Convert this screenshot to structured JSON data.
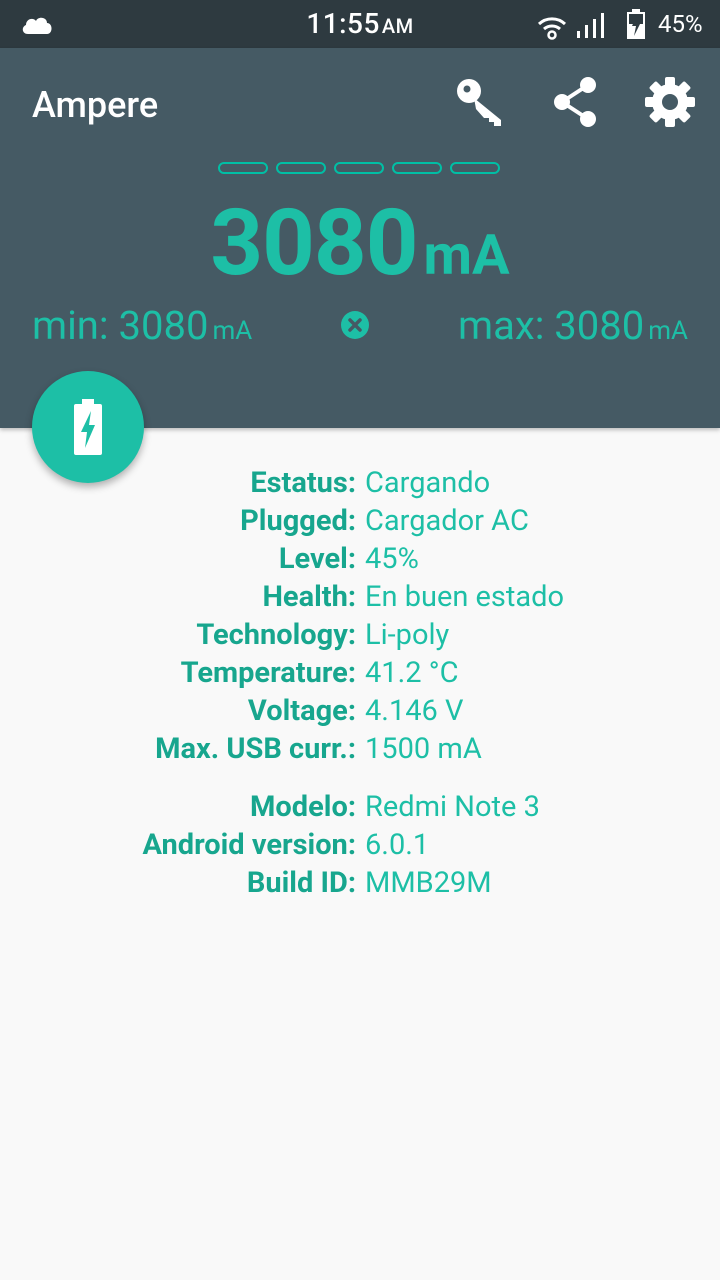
{
  "status_bar": {
    "time": "11:55",
    "ampm": "AM",
    "battery_percent": "45%"
  },
  "toolbar": {
    "title": "Ampere",
    "actions": [
      "key-icon",
      "share-icon",
      "gear-icon"
    ]
  },
  "meter": {
    "current_value": "3080",
    "current_unit": "mA",
    "min_label": "min: 3080",
    "min_unit": "mA",
    "max_label": "max: 3080",
    "max_unit": "mA",
    "accent_color": "#1dbfa6",
    "header_color": "#455a64"
  },
  "fab": {
    "icon": "battery-charging-icon"
  },
  "battery_info": [
    {
      "label": "Estatus:",
      "value": "Cargando"
    },
    {
      "label": "Plugged:",
      "value": "Cargador AC"
    },
    {
      "label": "Level:",
      "value": "45%"
    },
    {
      "label": "Health:",
      "value": "En buen estado"
    },
    {
      "label": "Technology:",
      "value": "Li-poly"
    },
    {
      "label": "Temperature:",
      "value": "41.2 °C"
    },
    {
      "label": "Voltage:",
      "value": "4.146 V"
    },
    {
      "label": "Max. USB curr.:",
      "value": "1500 mA"
    }
  ],
  "device_info": [
    {
      "label": "Modelo:",
      "value": "Redmi Note 3"
    },
    {
      "label": "Android version:",
      "value": "6.0.1"
    },
    {
      "label": "Build ID:",
      "value": "MMB29M"
    }
  ]
}
